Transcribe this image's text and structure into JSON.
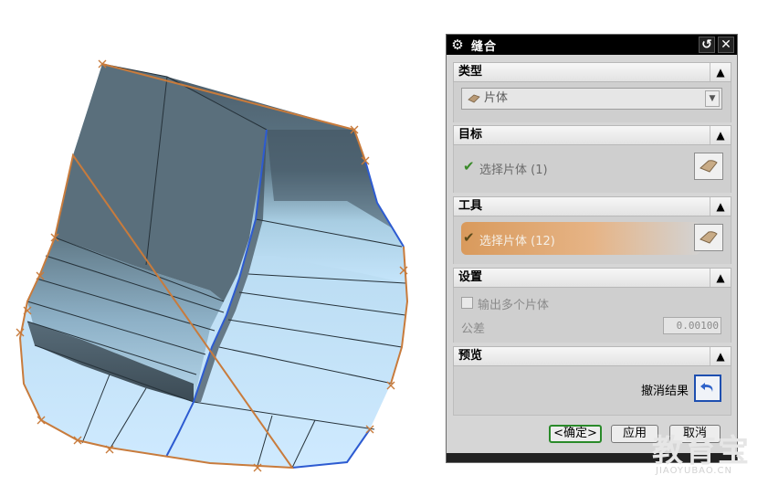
{
  "dialog": {
    "title": "缝合",
    "sections": {
      "type": {
        "header": "类型",
        "selected": "片体"
      },
      "target": {
        "header": "目标",
        "select_label": "选择片体 (1)"
      },
      "tool": {
        "header": "工具",
        "select_label": "选择片体 (12)"
      },
      "settings": {
        "header": "设置",
        "multi_sheet_label": "输出多个片体",
        "multi_sheet_checked": false,
        "tolerance_label": "公差",
        "tolerance_value": "0.00100"
      },
      "preview": {
        "header": "预览",
        "undo_label": "撤消结果"
      }
    },
    "buttons": {
      "ok": "<确定>",
      "apply": "应用",
      "cancel": "取消"
    }
  },
  "watermark": {
    "text": "教育宝",
    "subtext": "JIAOYUBAO.CN"
  },
  "colors": {
    "accent_orange": "#d99a5c",
    "surface_blue": "#b9dcf2",
    "surface_dark": "#506370",
    "edge_orange": "#c87b3c",
    "edge_blue": "#2d5bd1"
  }
}
